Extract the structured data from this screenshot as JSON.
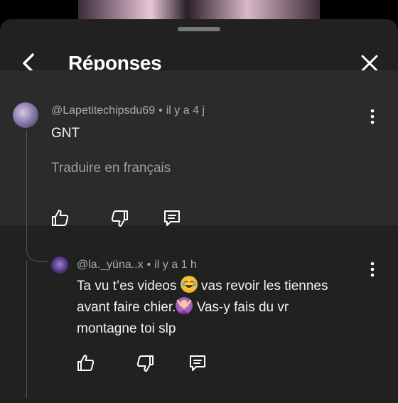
{
  "header": {
    "title": "Réponses"
  },
  "parent_comment": {
    "author": "@Lapetitechipsdu69",
    "separator": "•",
    "time": "il y a 4 j",
    "text": "GNT",
    "translate_label": "Traduire en français"
  },
  "reply": {
    "author": "@la._yüna..x",
    "separator": "•",
    "time": "il y a 1 h",
    "line1_a": "Ta vu t’es videos",
    "line1_b": "vas revoir les tiennes",
    "line2_a": "avant faire chier.",
    "line2_b": "Vas-y fais du vr",
    "line3": "montagne toi slp",
    "emoji1": "face-with-tears-of-joy",
    "emoji2": "person-shrugging"
  },
  "icons": {
    "back": "chevron-left-icon",
    "close": "close-icon",
    "more": "more-vert-icon",
    "like": "thumb-up-icon",
    "dislike": "thumb-down-icon",
    "reply": "comment-icon"
  },
  "colors": {
    "sheet_bg": "#212121",
    "highlight_bg": "#2b2b2b",
    "text_primary": "#f1f1f1",
    "text_secondary": "#aaaaaa"
  }
}
